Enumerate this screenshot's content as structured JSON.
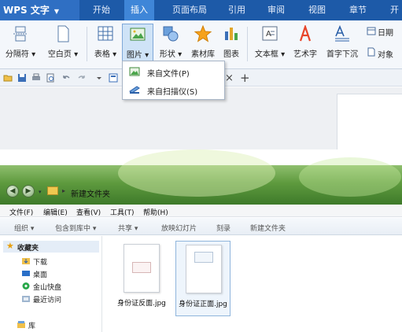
{
  "wps": {
    "app_name": "WPS 文字",
    "tabs": [
      "开始",
      "插入",
      "页面布局",
      "引用",
      "审阅",
      "视图",
      "章节",
      "开"
    ],
    "active_tab": "插入",
    "ribbon": {
      "page_break": "分隔符 ▾",
      "blank_page": "空白页 ▾",
      "table": "表格 ▾",
      "picture": "图片 ▾",
      "shape": "形状 ▾",
      "material": "素材库",
      "chart": "图表",
      "textbox": "文本框 ▾",
      "wordart": "艺术字",
      "dropcap": "首字下沉",
      "object": "对象",
      "datetime": "日期"
    },
    "picture_menu": {
      "from_file": "来自文件(P)",
      "from_scanner": "来自扫描仪(S)"
    },
    "doc_tab_close": "×",
    "new_tab": "+"
  },
  "explorer": {
    "path": "新建文件夹",
    "menu": [
      "文件(F)",
      "编辑(E)",
      "查看(V)",
      "工具(T)",
      "帮助(H)"
    ],
    "commands": [
      "组织 ▾",
      "包含到库中 ▾",
      "共享 ▾",
      "放映幻灯片",
      "刻录",
      "新建文件夹"
    ],
    "nav": {
      "favorites": "收藏夹",
      "items": [
        "下载",
        "桌面",
        "金山快盘",
        "最近访问"
      ],
      "library": "库"
    },
    "files": [
      "身份证反面.jpg",
      "身份证正面.jpg"
    ]
  },
  "colors": {
    "wps_blue": "#1d5aa8",
    "explorer_green": "#5e9a3e",
    "selection": "#cfe3f7"
  }
}
